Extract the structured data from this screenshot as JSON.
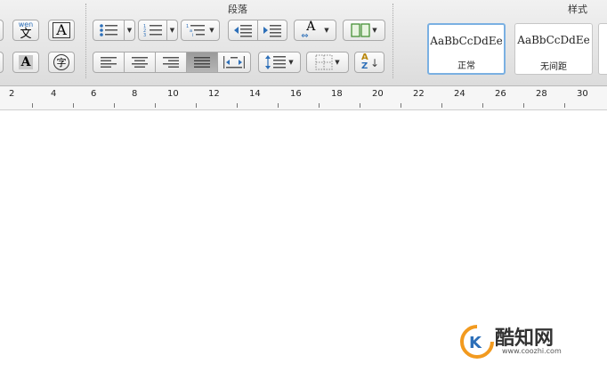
{
  "ribbon": {
    "groups": {
      "paragraph": "段落",
      "styles": "样式"
    },
    "font_buttons": {
      "wen_label": "wen",
      "wen_char": "文",
      "char_border": "A",
      "char_shade": "A",
      "enclose": "字"
    },
    "paragraph_buttons": {
      "text_direction": "A"
    },
    "style_gallery": [
      {
        "sample": "AaBbCcDdEe",
        "name": "正常",
        "selected": true
      },
      {
        "sample": "AaBbCcDdEe",
        "name": "无间距",
        "selected": false
      }
    ],
    "sort_label": {
      "a": "A",
      "z": "Z"
    }
  },
  "ruler": {
    "labels": [
      "2",
      "4",
      "6",
      "8",
      "10",
      "12",
      "14",
      "16",
      "18",
      "20",
      "22",
      "24",
      "26",
      "28",
      "30"
    ]
  },
  "watermark": {
    "brand": "酷知网",
    "url": "www.coozhi.com"
  },
  "colors": {
    "selected_style_border": "#7ab0e2",
    "icon_blue": "#2d6fb8",
    "watermark_orange": "#f29a1f"
  }
}
